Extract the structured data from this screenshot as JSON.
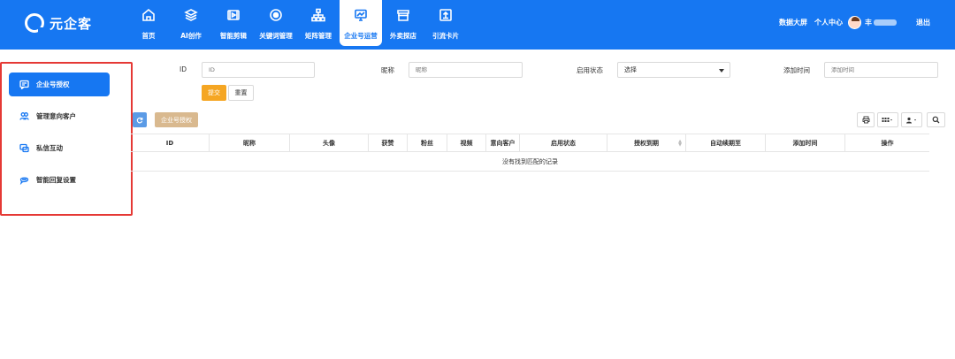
{
  "brand": {
    "name": "元企客"
  },
  "nav": {
    "items": [
      {
        "label": "首页",
        "icon": "home-icon"
      },
      {
        "label": "AI创作",
        "icon": "layers-icon"
      },
      {
        "label": "智能剪辑",
        "icon": "video-icon"
      },
      {
        "label": "关键词管理",
        "icon": "target-icon"
      },
      {
        "label": "矩阵管理",
        "icon": "sitemap-icon"
      },
      {
        "label": "企业号运营",
        "icon": "monitor-icon",
        "active": true
      },
      {
        "label": "外卖探店",
        "icon": "store-icon"
      },
      {
        "label": "引流卡片",
        "icon": "upload-icon"
      }
    ]
  },
  "header_right": {
    "dashboard": "数据大屏",
    "profile": "个人中心",
    "username": "丰",
    "logout": "退出"
  },
  "sidebar": {
    "items": [
      {
        "label": "企业号授权",
        "icon": "auth-icon",
        "active": true
      },
      {
        "label": "管理意向客户",
        "icon": "users-icon"
      },
      {
        "label": "私信互动",
        "icon": "chat-icon"
      },
      {
        "label": "智能回复设置",
        "icon": "reply-icon"
      }
    ]
  },
  "search": {
    "id_label": "ID",
    "id_placeholder": "ID",
    "nickname_label": "昵称",
    "nickname_placeholder": "昵称",
    "status_label": "启用状态",
    "status_value": "选择",
    "time_label": "添加时间",
    "time_placeholder": "添加时间",
    "submit": "提交",
    "reset": "重置"
  },
  "toolbar": {
    "refresh_icon": "refresh-icon",
    "auth_button": "企业号授权"
  },
  "table": {
    "columns": [
      "ID",
      "昵称",
      "头像",
      "获赞",
      "粉丝",
      "视频",
      "意向客户",
      "启用状态",
      "授权到期",
      "自动续期至",
      "添加时间",
      "操作"
    ],
    "empty_text": "没有找到匹配的记录"
  },
  "colors": {
    "primary": "#1677f2",
    "submit": "#f5a623",
    "highlight_border": "#e53935"
  }
}
